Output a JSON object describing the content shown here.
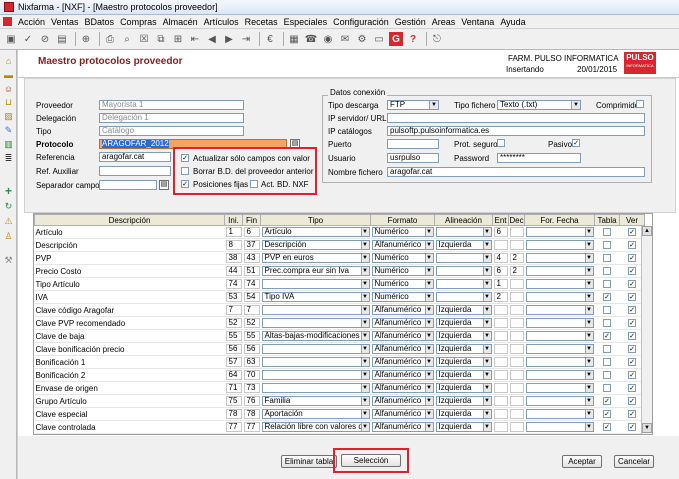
{
  "window": {
    "title": "Nixfarma - [NXF] - [Maestro protocolos proveedor]"
  },
  "menu": [
    "Acción",
    "Ventas",
    "BDatos",
    "Compras",
    "Almacén",
    "Artículos",
    "Recetas",
    "Especiales",
    "Configuración",
    "Gestión",
    "Areas",
    "Ventana",
    "Ayuda"
  ],
  "form": {
    "title": "Maestro protocolos proveedor",
    "company": "FARM. PULSO INFORMATICA",
    "mode": "Insertando",
    "date": "20/01/2015",
    "logo_text": "PULSO",
    "logo_sub": "INFORMATICA"
  },
  "labels": {
    "proveedor": "Proveedor",
    "delegacion": "Delegación",
    "tipo": "Tipo",
    "protocolo": "Protocolo",
    "referencia": "Referencia",
    "ref_auxiliar": "Ref. Auxiliar",
    "separador": "Separador campos"
  },
  "values": {
    "proveedor": "Mayorista 1",
    "delegacion": "Delegación 1",
    "tipo": "Catálogo",
    "protocolo": "ARAGOFAR_2012",
    "referencia": "aragofar.cat",
    "ref_auxiliar": "",
    "separador": ""
  },
  "options": {
    "actualizar": "Actualizar sólo campos con valor",
    "borrar": "Borrar B.D. del proveedor anterior",
    "posiciones": "Posiciones fijas",
    "act_bd": "Act. BD. NXF"
  },
  "conexion": {
    "title": "Datos conexión",
    "tipo_descarga_label": "Tipo descarga",
    "tipo_descarga": "FTP",
    "tipo_fichero_label": "Tipo fichero",
    "tipo_fichero": "Texto (.txt)",
    "comprimido_label": "Comprimido",
    "ip_servidor_label": "IP servidor/ URL",
    "ip_servidor": "",
    "ip_catalogos_label": "IP catálogos",
    "ip_catalogos": "pulsoftp.pulsoinformatica.es",
    "puerto_label": "Puerto",
    "puerto": "",
    "prot_seguro_label": "Prot. seguro",
    "pasivo_label": "Pasivo",
    "usuario_label": "Usuario",
    "usuario": "usrpulso",
    "password_label": "Password",
    "password": "********",
    "nombre_fichero_label": "Nombre fichero",
    "nombre_fichero": "aragofar.cat"
  },
  "grid": {
    "headers": [
      "Descripción",
      "Ini.",
      "Fin",
      "Tipo",
      "Formato",
      "Alineación",
      "Ent",
      "Dec",
      "For. Fecha",
      "Tabla",
      "Ver"
    ],
    "rows": [
      {
        "desc": "Artículo",
        "ini": "1",
        "fin": "6",
        "tipo": "Artículo",
        "formato": "Numérico",
        "alin": "",
        "ent": "6",
        "dec": "",
        "tabla": false,
        "ver": true
      },
      {
        "desc": "Descripción",
        "ini": "8",
        "fin": "37",
        "tipo": "Descripción",
        "formato": "Alfanumérico",
        "alin": "Izquierda",
        "ent": "",
        "dec": "",
        "tabla": false,
        "ver": true
      },
      {
        "desc": "PVP",
        "ini": "38",
        "fin": "43",
        "tipo": "PVP  en euros",
        "formato": "Numérico",
        "alin": "",
        "ent": "4",
        "dec": "2",
        "tabla": false,
        "ver": true
      },
      {
        "desc": "Precio Costo",
        "ini": "44",
        "fin": "51",
        "tipo": "Prec.compra eur sin Iva",
        "formato": "Numérico",
        "alin": "",
        "ent": "6",
        "dec": "2",
        "tabla": false,
        "ver": true
      },
      {
        "desc": "Tipo Artículo",
        "ini": "74",
        "fin": "74",
        "tipo": "",
        "formato": "Numérico",
        "alin": "",
        "ent": "1",
        "dec": "",
        "tabla": false,
        "ver": true
      },
      {
        "desc": "IVA",
        "ini": "53",
        "fin": "54",
        "tipo": "Tipo IVA",
        "formato": "Numérico",
        "alin": "",
        "ent": "2",
        "dec": "",
        "tabla": true,
        "ver": true
      },
      {
        "desc": "Clave código Aragofar",
        "ini": "7",
        "fin": "7",
        "tipo": "",
        "formato": "Alfanumérico",
        "alin": "Izquierda",
        "ent": "",
        "dec": "",
        "tabla": false,
        "ver": true
      },
      {
        "desc": "Clave PVP recomendado",
        "ini": "52",
        "fin": "52",
        "tipo": "",
        "formato": "Alfanumérico",
        "alin": "Izquierda",
        "ent": "",
        "dec": "",
        "tabla": false,
        "ver": true
      },
      {
        "desc": "Clave de baja",
        "ini": "55",
        "fin": "55",
        "tipo": "Altas-bajas-modificaciones",
        "formato": "Alfanumérico",
        "alin": "Izquierda",
        "ent": "",
        "dec": "",
        "tabla": true,
        "ver": true
      },
      {
        "desc": "Clave bonificación precio",
        "ini": "56",
        "fin": "56",
        "tipo": "",
        "formato": "Alfanumérico",
        "alin": "Izquierda",
        "ent": "",
        "dec": "",
        "tabla": false,
        "ver": true
      },
      {
        "desc": "Bonificación 1",
        "ini": "57",
        "fin": "63",
        "tipo": "",
        "formato": "Alfanumérico",
        "alin": "Izquierda",
        "ent": "",
        "dec": "",
        "tabla": false,
        "ver": true
      },
      {
        "desc": "Bonificación 2",
        "ini": "64",
        "fin": "70",
        "tipo": "",
        "formato": "Alfanumérico",
        "alin": "Izquierda",
        "ent": "",
        "dec": "",
        "tabla": false,
        "ver": true
      },
      {
        "desc": "Envase de origen",
        "ini": "71",
        "fin": "73",
        "tipo": "",
        "formato": "Alfanumérico",
        "alin": "Izquierda",
        "ent": "",
        "dec": "",
        "tabla": false,
        "ver": true
      },
      {
        "desc": "Grupo Artículo",
        "ini": "75",
        "fin": "76",
        "tipo": "Familia",
        "formato": "Alfanumérico",
        "alin": "Izquierda",
        "ent": "",
        "dec": "",
        "tabla": true,
        "ver": true
      },
      {
        "desc": "Clave especial",
        "ini": "78",
        "fin": "78",
        "tipo": "Aportación",
        "formato": "Alfanumérico",
        "alin": "Izquierda",
        "ent": "",
        "dec": "",
        "tabla": true,
        "ver": true
      },
      {
        "desc": "Clave controlada",
        "ini": "77",
        "fin": "77",
        "tipo": "Relación libre con valores d",
        "formato": "Alfanumérico",
        "alin": "Izquierda",
        "ent": "",
        "dec": "",
        "tabla": true,
        "ver": true
      }
    ]
  },
  "buttons": {
    "eliminar": "Eliminar tabla",
    "seleccion": "Selección",
    "aceptar": "Aceptar",
    "cancelar": "Cancelar"
  },
  "colors": {
    "accent_red": "#e2202c",
    "title_red": "#8b1a1a",
    "protocol_highlight": "#f4a460"
  }
}
